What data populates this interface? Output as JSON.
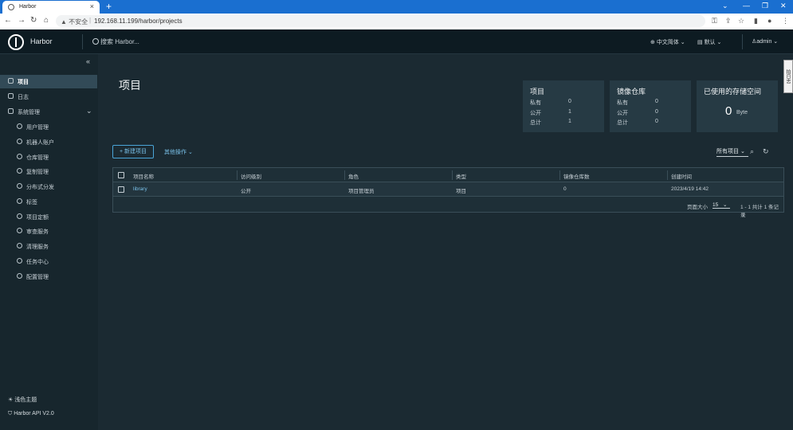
{
  "browser": {
    "tab_title": "Harbor",
    "url_warning": "不安全",
    "url": "192.168.11.199/harbor/projects"
  },
  "header": {
    "app_name": "Harbor",
    "search_placeholder": "搜索 Harbor...",
    "language": "中文简体",
    "theme_menu": "默认",
    "user": "admin"
  },
  "sidebar": {
    "items": [
      {
        "label": "项目"
      },
      {
        "label": "日志"
      },
      {
        "label": "系统管理"
      }
    ],
    "sub_items": [
      {
        "label": "用户管理"
      },
      {
        "label": "机器人账户"
      },
      {
        "label": "仓库管理"
      },
      {
        "label": "复制管理"
      },
      {
        "label": "分布式分发"
      },
      {
        "label": "标签"
      },
      {
        "label": "项目定额"
      },
      {
        "label": "审查服务"
      },
      {
        "label": "清理服务"
      },
      {
        "label": "任务中心"
      },
      {
        "label": "配置管理"
      }
    ],
    "theme_toggle": "浅色主题",
    "api_link": "Harbor API V2.0"
  },
  "vertical_tab": "拍日志",
  "page": {
    "title": "项目"
  },
  "cards": {
    "projects": {
      "title": "项目",
      "rows": [
        {
          "label": "私有",
          "value": "0"
        },
        {
          "label": "公开",
          "value": "1"
        },
        {
          "label": "总计",
          "value": "1"
        }
      ]
    },
    "repositories": {
      "title": "镜像仓库",
      "rows": [
        {
          "label": "私有",
          "value": "0"
        },
        {
          "label": "公开",
          "value": "0"
        },
        {
          "label": "总计",
          "value": "0"
        }
      ]
    },
    "storage": {
      "title": "已使用的存储空间",
      "value": "0",
      "unit": "Byte"
    }
  },
  "toolbar": {
    "new_project": "+ 新建项目",
    "other_ops": "其他操作",
    "filter": "所有项目"
  },
  "table": {
    "columns": [
      "项目名称",
      "访问级别",
      "角色",
      "类型",
      "镜像仓库数",
      "创建时间"
    ],
    "rows": [
      {
        "name": "library",
        "access": "公开",
        "role": "项目管理员",
        "type": "项目",
        "repo_count": "0",
        "created": "2023/4/19 14:42"
      }
    ],
    "page_size_label": "页面大小",
    "page_size": "15",
    "range": "1 - 1 共计 1 条记录"
  }
}
